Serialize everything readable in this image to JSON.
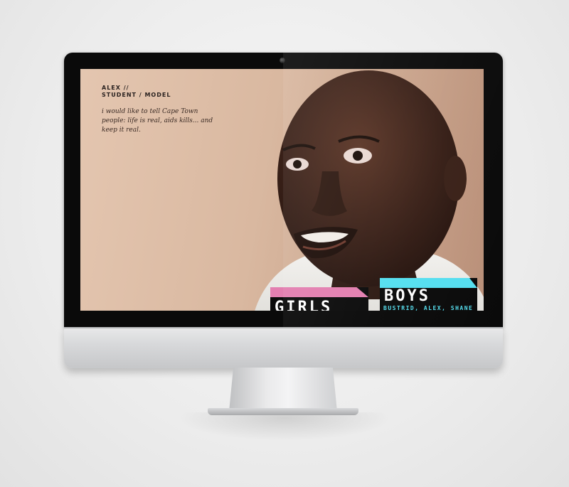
{
  "profile": {
    "name": "ALEX //",
    "role": "STUDENT / MODEL",
    "quote": "i would like to tell Cape Town people: life is real, aids kills... and keep it real."
  },
  "badges": {
    "girls": {
      "title": "GIRLS",
      "color": "#e37fb0"
    },
    "boys": {
      "title": "BOYS",
      "subtitle": "BUSTRID, ALEX, SHANE",
      "color": "#55dff0"
    }
  }
}
